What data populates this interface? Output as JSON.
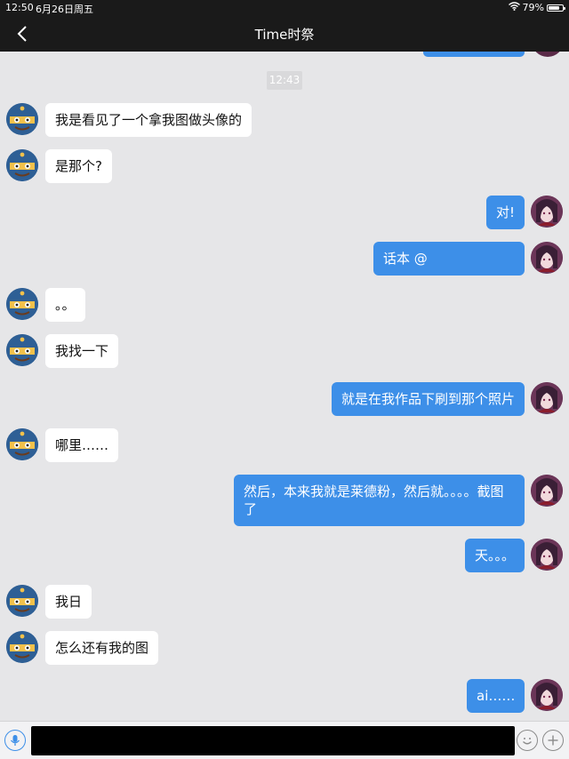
{
  "status_bar": {
    "time": "12:50",
    "date": "6月26日周五",
    "battery": "79%",
    "battery_level": 0.79
  },
  "header": {
    "title": "Time时祭",
    "background": "#1a1a1a"
  },
  "chat": {
    "timestamp": "12:43",
    "colors": {
      "outgoing": "#3d8fe8",
      "incoming": "#ffffff",
      "background": "#e6e6e8"
    },
    "messages": [
      {
        "side": "in",
        "text": "我是看见了一个拿我图做头像的"
      },
      {
        "side": "in",
        "text": "是那个?"
      },
      {
        "side": "out",
        "text": "对!"
      },
      {
        "side": "out",
        "text": "话本 @"
      },
      {
        "side": "in",
        "text": "。。"
      },
      {
        "side": "in",
        "text": "我找一下"
      },
      {
        "side": "out",
        "text": "就是在我作品下刷到那个照片"
      },
      {
        "side": "in",
        "text": "哪里……"
      },
      {
        "side": "out",
        "text": "然后，本来我就是莱德粉，然后就。。。。截图了"
      },
      {
        "side": "out",
        "text": "天。。。"
      },
      {
        "side": "in",
        "text": "我日"
      },
      {
        "side": "in",
        "text": "怎么还有我的图"
      },
      {
        "side": "out",
        "text": "ai……"
      }
    ]
  },
  "input_bar": {
    "icons": [
      "microphone-icon",
      "emoji-icon",
      "plus-icon"
    ]
  }
}
